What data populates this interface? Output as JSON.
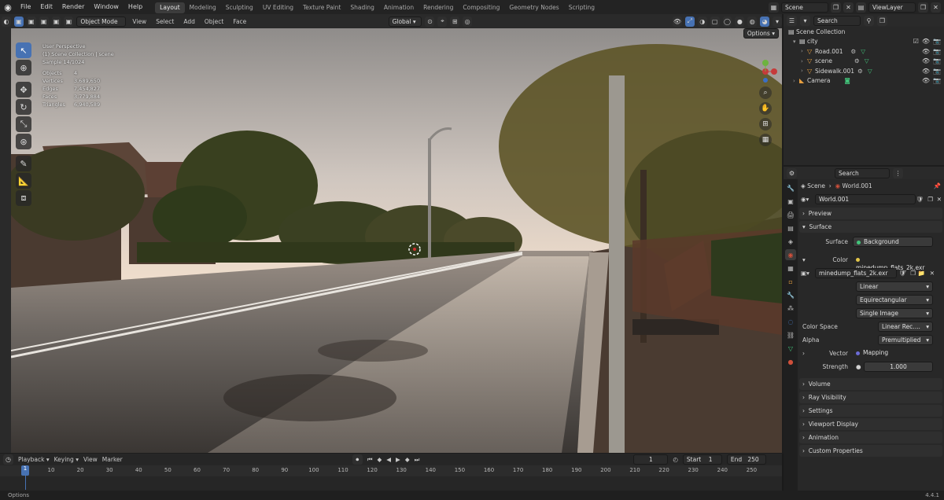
{
  "topbar": {
    "menus": [
      "File",
      "Edit",
      "Render",
      "Window",
      "Help"
    ],
    "workspaces": [
      "Layout",
      "Modeling",
      "Sculpting",
      "UV Editing",
      "Texture Paint",
      "Shading",
      "Animation",
      "Rendering",
      "Compositing",
      "Geometry Nodes",
      "Scripting"
    ],
    "active_workspace": "Layout",
    "scene_name": "Scene",
    "view_layer": "ViewLayer",
    "search_placeholder": "Search"
  },
  "viewport_header": {
    "mode": "Object Mode",
    "menus": [
      "View",
      "Select",
      "Add",
      "Object",
      "Face"
    ],
    "transform_orientation": "Global",
    "options_label": "Options"
  },
  "viewport_overlay": {
    "view_name": "User Perspective",
    "collection_line": "(1) Scene Collection | scene",
    "sample_line": "Sample 14/1024",
    "stats": [
      {
        "k": "Objects",
        "v": "4"
      },
      {
        "k": "Vertices",
        "v": "3,689,650"
      },
      {
        "k": "Edges",
        "v": "7,454,827"
      },
      {
        "k": "Faces",
        "v": "3,779,884"
      },
      {
        "k": "Triangles",
        "v": "6,940,589"
      }
    ]
  },
  "outliner": {
    "search_placeholder": "Search",
    "root": "Scene Collection",
    "rows": [
      {
        "label": "city",
        "indent": 1
      },
      {
        "label": "Road.001",
        "indent": 2
      },
      {
        "label": "scene",
        "indent": 2
      },
      {
        "label": "Sidewalk.001",
        "indent": 2
      },
      {
        "label": "Camera",
        "indent": 1
      }
    ]
  },
  "properties": {
    "search_placeholder": "Search",
    "breadcrumb_scene": "Scene",
    "breadcrumb_world": "World.001",
    "world_name": "World.001",
    "panels": {
      "preview": "Preview",
      "surface": "Surface",
      "volume": "Volume",
      "ray_visibility": "Ray Visibility",
      "settings": "Settings",
      "viewport_display": "Viewport Display",
      "animation": "Animation",
      "custom_properties": "Custom Properties"
    },
    "surface_label": "Surface",
    "surface_value": "Background",
    "color_label": "Color",
    "color_value": "minedump_flats_2k.exr",
    "image_name": "minedump_flats_2k.exr",
    "interpolation": "Linear",
    "projection": "Equirectangular",
    "extension": "Single Image",
    "color_space_label": "Color Space",
    "color_space_value": "Linear Rec....",
    "alpha_label": "Alpha",
    "alpha_value": "Premultiplied",
    "vector_label": "Vector",
    "vector_value": "Mapping",
    "strength_label": "Strength",
    "strength_value": "1.000"
  },
  "timeline": {
    "menus": [
      "Playback",
      "Keying",
      "View",
      "Marker"
    ],
    "current_frame": "1",
    "start_label": "Start",
    "start_value": "1",
    "end_label": "End",
    "end_value": "250",
    "ticks": [
      "10",
      "20",
      "30",
      "40",
      "50",
      "60",
      "70",
      "80",
      "90",
      "100",
      "110",
      "120",
      "130",
      "140",
      "150",
      "160",
      "170",
      "180",
      "190",
      "200",
      "210",
      "220",
      "230",
      "240",
      "250"
    ],
    "playhead_label": "1"
  },
  "statusbar": {
    "left": "Options",
    "version": "4.4.1"
  },
  "colors": {
    "accent": "#4772b3",
    "bg": "#1d1d1d"
  }
}
